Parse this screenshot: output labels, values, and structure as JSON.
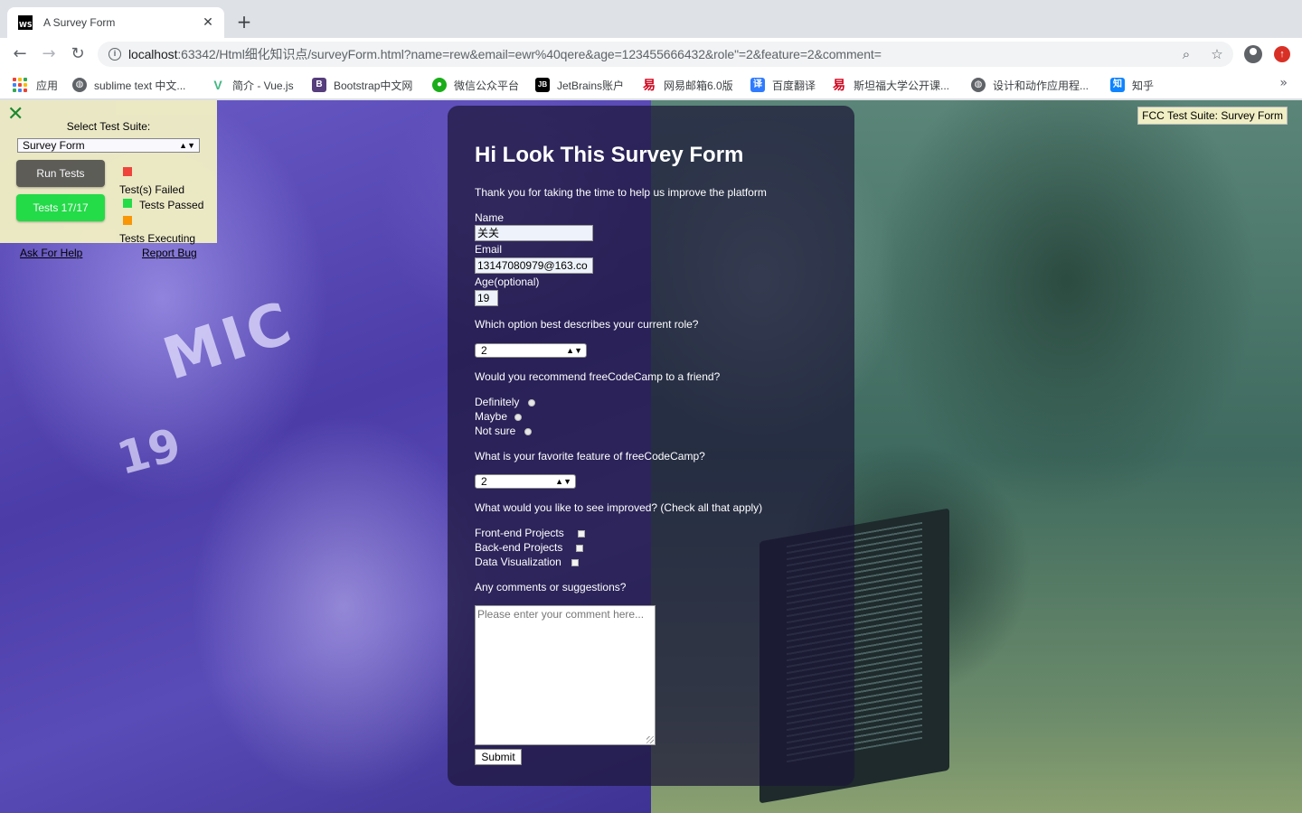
{
  "browser": {
    "tab_title": "A Survey Form",
    "tab_favicon_text": "WS",
    "url_host": "localhost",
    "url_rest": ":63342/Html细化知识点/surveyForm.html?name=rew&email=ewr%40qere&age=123455666432&role\"=2&feature=2&comment=",
    "bookmarks": [
      {
        "label": "应用",
        "icon": "apps-grid-icon"
      },
      {
        "label": "sublime text 中文...",
        "icon": "globe-icon"
      },
      {
        "label": "简介 - Vue.js",
        "icon": "vue-icon",
        "color": "#41b883"
      },
      {
        "label": "Bootstrap中文网",
        "icon": "bootstrap-icon",
        "color": "#563d7c"
      },
      {
        "label": "微信公众平台",
        "icon": "wechat-icon",
        "color": "#1aad19"
      },
      {
        "label": "JetBrains账户",
        "icon": "jetbrains-icon",
        "color": "#000000"
      },
      {
        "label": "网易邮箱6.0版",
        "icon": "netease-icon",
        "color": "#d0021b"
      },
      {
        "label": "百度翻译",
        "icon": "baidu-translate-icon",
        "color": "#2f7bff"
      },
      {
        "label": "斯坦福大学公开课...",
        "icon": "netease-icon",
        "color": "#d0021b"
      },
      {
        "label": "设计和动作应用程...",
        "icon": "globe-icon"
      },
      {
        "label": "知乎",
        "icon": "zhihu-icon",
        "color": "#0e84ff"
      }
    ]
  },
  "fcc": {
    "select_label": "Select Test Suite:",
    "selected_suite": "Survey Form",
    "run_tests": "Run Tests",
    "tests_result": "Tests 17/17",
    "legend_failed": "Test(s) Failed",
    "legend_passed": "Tests Passed",
    "legend_executing": "Tests Executing",
    "ask_help": "Ask For Help",
    "report_bug": "Report Bug",
    "badge": "FCC Test Suite: Survey Form",
    "colors": {
      "failed": "#f44336",
      "passed": "#21e043",
      "executing": "#ff9800"
    }
  },
  "form": {
    "title": "Hi Look This Survey Form",
    "description": "Thank you for taking the time to help us improve the platform",
    "name_label": "Name",
    "name_value": "关关",
    "email_label": "Email",
    "email_value": "13147080979@163.co",
    "age_label": "Age(optional)",
    "age_value": "19",
    "role_question": "Which option best describes your current role?",
    "role_value": "2",
    "recommend_question": "Would you recommend freeCodeCamp to a friend?",
    "recommend_options": [
      "Definitely",
      "Maybe",
      "Not sure"
    ],
    "feature_question": "What is your favorite feature of freeCodeCamp?",
    "feature_value": "2",
    "improve_question": "What would you like to see improved? (Check all that apply)",
    "improve_options": [
      "Front-end Projects",
      "Back-end Projects",
      "Data Visualization"
    ],
    "comment_question": "Any comments or suggestions?",
    "comment_placeholder": "Please enter your comment here...",
    "submit_label": "Submit"
  },
  "background": {
    "jersey_text": "MIC",
    "jersey_number": "19"
  }
}
